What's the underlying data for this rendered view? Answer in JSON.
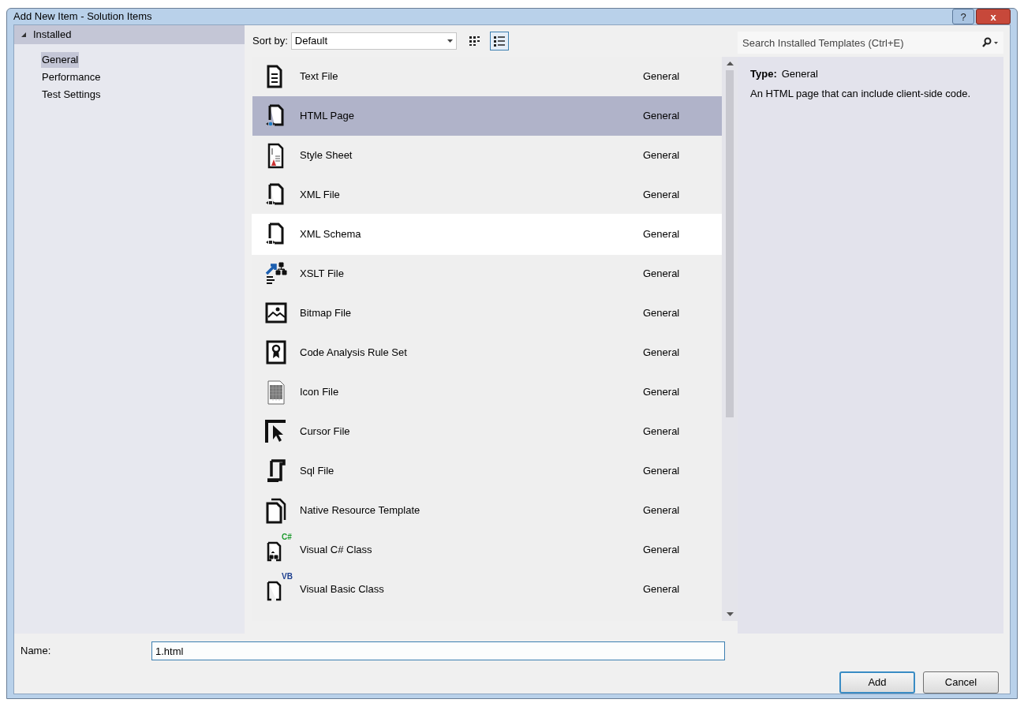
{
  "window": {
    "title": "Add New Item - Solution Items",
    "title_buttons": [
      {
        "kind": "help",
        "label": "?"
      },
      {
        "kind": "close",
        "label": "x"
      }
    ]
  },
  "sidebar": {
    "header": {
      "label": "Installed",
      "expanded": true
    },
    "items": [
      {
        "label": "General",
        "selected": true
      },
      {
        "label": "Performance",
        "selected": false
      },
      {
        "label": "Test Settings",
        "selected": false
      }
    ]
  },
  "toolbar": {
    "sort_label": "Sort by:",
    "sort_value": "Default",
    "views": [
      {
        "kind": "tiles",
        "selected": false
      },
      {
        "kind": "list",
        "selected": true
      }
    ]
  },
  "templates": [
    {
      "kind": "text",
      "name": "Text File",
      "type": "General",
      "selected": false,
      "hovered": false
    },
    {
      "kind": "html",
      "name": "HTML Page",
      "type": "General",
      "selected": true,
      "hovered": false
    },
    {
      "kind": "css",
      "name": "Style Sheet",
      "type": "General",
      "selected": false,
      "hovered": false
    },
    {
      "kind": "xml",
      "name": "XML File",
      "type": "General",
      "selected": false,
      "hovered": false
    },
    {
      "kind": "xml",
      "name": "XML Schema",
      "type": "General",
      "selected": false,
      "hovered": true
    },
    {
      "kind": "xslt",
      "name": "XSLT File",
      "type": "General",
      "selected": false,
      "hovered": false
    },
    {
      "kind": "bitmap",
      "name": "Bitmap File",
      "type": "General",
      "selected": false,
      "hovered": false
    },
    {
      "kind": "ruleset",
      "name": "Code Analysis Rule Set",
      "type": "General",
      "selected": false,
      "hovered": false
    },
    {
      "kind": "iconfile",
      "name": "Icon File",
      "type": "General",
      "selected": false,
      "hovered": false
    },
    {
      "kind": "cursor",
      "name": "Cursor File",
      "type": "General",
      "selected": false,
      "hovered": false
    },
    {
      "kind": "sql",
      "name": "Sql File",
      "type": "General",
      "selected": false,
      "hovered": false
    },
    {
      "kind": "native",
      "name": "Native Resource Template",
      "type": "General",
      "selected": false,
      "hovered": false
    },
    {
      "kind": "csharp",
      "badge": "C#",
      "name": "Visual C# Class",
      "type": "General",
      "selected": false,
      "hovered": false
    },
    {
      "kind": "vb",
      "badge": "VB",
      "name": "Visual Basic Class",
      "type": "General",
      "selected": false,
      "hovered": false
    }
  ],
  "search": {
    "placeholder": "Search Installed Templates (Ctrl+E)"
  },
  "details": {
    "type_label": "Type:",
    "type_value": "General",
    "description": "An HTML page that can include client-side code."
  },
  "name_field": {
    "label": "Name:",
    "value": "1.html"
  },
  "buttons": [
    {
      "label": "Add",
      "default": true
    },
    {
      "label": "Cancel",
      "default": false
    }
  ]
}
